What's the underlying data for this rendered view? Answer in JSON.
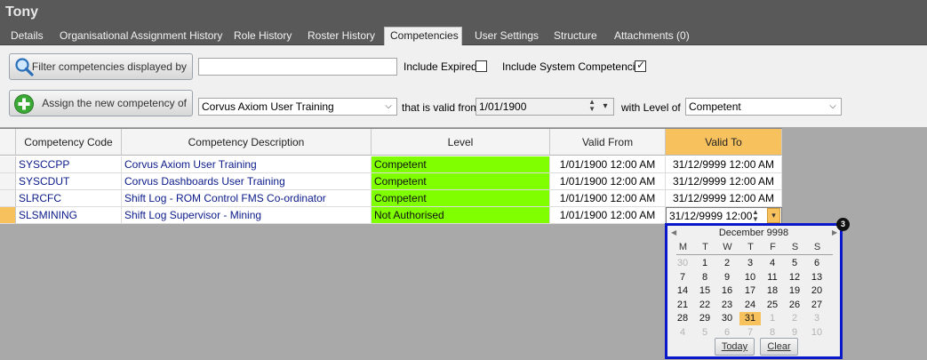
{
  "window": {
    "title": "Tony"
  },
  "tabs": [
    "Details",
    "Organisational Assignment History",
    "Role History",
    "Roster History",
    "Competencies",
    "User Settings",
    "Structure",
    "Attachments (0)"
  ],
  "active_tab": "Competencies",
  "filter": {
    "button_label": "Filter competencies displayed by",
    "text_value": "",
    "include_expired_label": "Include Expired",
    "include_expired": false,
    "include_system_label": "Include System Competencies",
    "include_system": true
  },
  "assign": {
    "button_label": "Assign the new competency of",
    "competency_value": "Corvus Axiom User Training",
    "valid_from_label": "that is valid from",
    "valid_from_value": "1/01/1900",
    "level_label": "with Level of",
    "level_value": "Competent"
  },
  "grid": {
    "columns": [
      "Competency Code",
      "Competency Description",
      "Level",
      "Valid From",
      "Valid To"
    ],
    "sorted_column": "Valid To",
    "rows": [
      {
        "code": "SYSCCPP",
        "description": "Corvus Axiom User Training",
        "level": "Competent",
        "valid_from": "1/01/1900 12:00 AM",
        "valid_to": "31/12/9999 12:00 AM"
      },
      {
        "code": "SYSCDUT",
        "description": "Corvus Dashboards User Training",
        "level": "Competent",
        "valid_from": "1/01/1900 12:00 AM",
        "valid_to": "31/12/9999 12:00 AM"
      },
      {
        "code": "SLRCFC",
        "description": "Shift Log - ROM Control FMS Co-ordinator",
        "level": "Competent",
        "valid_from": "1/01/1900 12:00 AM",
        "valid_to": "31/12/9999 12:00 AM"
      },
      {
        "code": "SLSMINING",
        "description": "Shift Log Supervisor - Mining",
        "level": "Not Authorised",
        "valid_from": "1/01/1900 12:00 AM",
        "valid_to": "31/12/9999 12:00"
      }
    ],
    "level_color": "#7fff00",
    "accent_color": "#f7c15d"
  },
  "calendar": {
    "badge": "3",
    "month_label": "December 9998",
    "weekdays": [
      "M",
      "T",
      "W",
      "T",
      "F",
      "S",
      "S"
    ],
    "weeks": [
      [
        "30",
        "1",
        "2",
        "3",
        "4",
        "5",
        "6"
      ],
      [
        "7",
        "8",
        "9",
        "10",
        "11",
        "12",
        "13"
      ],
      [
        "14",
        "15",
        "16",
        "17",
        "18",
        "19",
        "20"
      ],
      [
        "21",
        "22",
        "23",
        "24",
        "25",
        "26",
        "27"
      ],
      [
        "28",
        "29",
        "30",
        "31",
        "1",
        "2",
        "3"
      ],
      [
        "4",
        "5",
        "6",
        "7",
        "8",
        "9",
        "10"
      ]
    ],
    "selected_day": "31",
    "today_label": "Today",
    "clear_label": "Clear",
    "border_color": "#0b18c9"
  }
}
